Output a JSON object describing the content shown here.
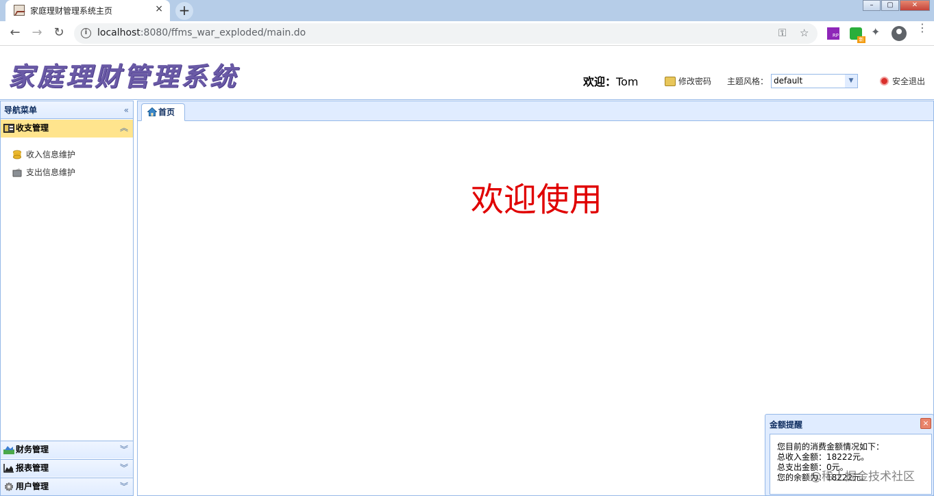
{
  "browser": {
    "tab_title": "家庭理财管理系统主页",
    "tab_close": "×",
    "new_tab": "+",
    "url_host": "localhost",
    "url_rest": ":8080/ffms_war_exploded/main.do",
    "info_icon": "i",
    "back_icon": "←",
    "forward_icon": "→",
    "reload_icon": "↻",
    "key_icon": "⚿",
    "star_icon": "☆",
    "ext_rp_label": "RP",
    "ext_wx_badge": "新",
    "puzzle_icon": "✦",
    "menu_icon": "⋮",
    "win_min": "–",
    "win_max": "▢",
    "win_close": "✕"
  },
  "header": {
    "logo": "家庭理财管理系统",
    "welcome_label": "欢迎：",
    "welcome_user": "Tom",
    "change_password": "修改密码",
    "theme_label": "主题风格：",
    "theme_value": "default",
    "theme_arrow": "▼",
    "logout": "安全退出"
  },
  "nav": {
    "title": "导航菜单",
    "collapse_icon": "«",
    "sections": [
      {
        "label": "收支管理",
        "tool": "︽",
        "items": [
          "收入信息维护",
          "支出信息维护"
        ]
      },
      {
        "label": "财务管理",
        "tool": "︾"
      },
      {
        "label": "报表管理",
        "tool": "︾"
      },
      {
        "label": "用户管理",
        "tool": "︾"
      }
    ]
  },
  "center": {
    "tab_home": "首页",
    "welcome_text": "欢迎使用"
  },
  "messager": {
    "title": "金额提醒",
    "close": "×",
    "lines": [
      "您目前的消费金额情况如下：",
      "总收入金额：18222元。",
      "总支出金额：0元。",
      "您的余额为：18222元。"
    ]
  },
  "watermark": "@稀土掘金技术社区",
  "colors": {
    "accent_border": "#95b8e7",
    "panel_header": "#e0ecff",
    "selected_section": "#ffe48d",
    "welcome_red": "#e00000",
    "logo_purple": "#6a5aa6"
  }
}
